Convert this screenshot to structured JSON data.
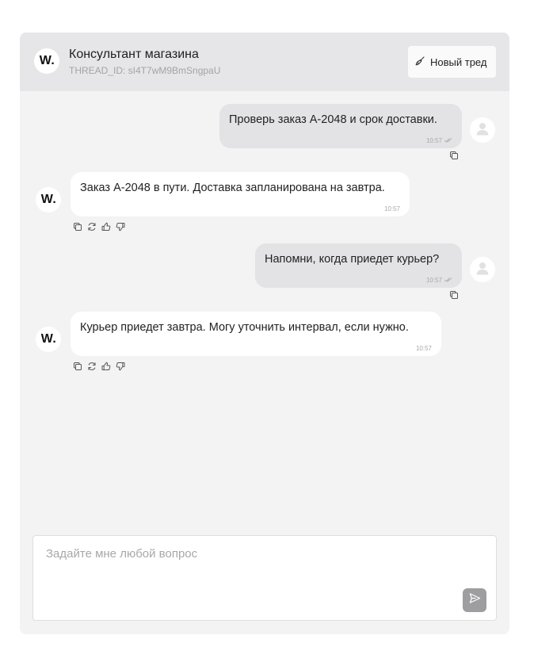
{
  "header": {
    "logo_text": "W",
    "logo_dot": ".",
    "title": "Консультант магазина",
    "thread_id": "THREAD_ID: sI4T7wM9BmSngpaU",
    "new_thread_label": "Новый тред"
  },
  "messages": [
    {
      "role": "user",
      "text": "Проверь заказ A-2048 и срок доставки.",
      "time": "10:57",
      "read": true
    },
    {
      "role": "bot",
      "text": "Заказ A-2048 в пути. Доставка запланирована на завтра.",
      "time": "10:57"
    },
    {
      "role": "user",
      "text": "Напомни, когда приедет курьер?",
      "time": "10:57",
      "read": true
    },
    {
      "role": "bot",
      "text": "Курьер приедет завтра. Могу уточнить интервал, если нужно.",
      "time": "10:57"
    }
  ],
  "composer": {
    "placeholder": "Задайте мне любой вопрос",
    "value": ""
  },
  "icons": {
    "new_thread": "broom-icon",
    "user_avatar": "user-icon",
    "copy": "copy-icon",
    "regenerate": "refresh-icon",
    "like": "thumbs-up-icon",
    "dislike": "thumbs-down-icon",
    "read_status": "double-check-icon",
    "send": "send-icon"
  },
  "colors": {
    "header_bg": "#e6e6e8",
    "chat_bg": "#f3f3f4",
    "user_bubble": "#e3e3e6",
    "bot_bubble": "#ffffff",
    "send_button": "#9e9ea0"
  }
}
